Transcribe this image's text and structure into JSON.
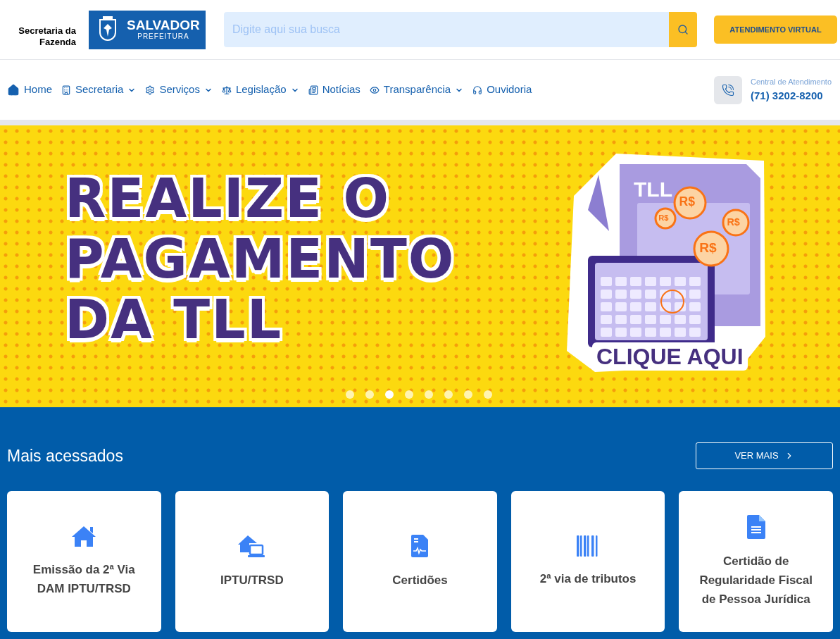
{
  "header": {
    "org_name": "Secretaria da Fazenda",
    "logo": {
      "title": "SALVADOR",
      "subtitle": "PREFEITURA"
    },
    "search": {
      "placeholder": "Digite aqui sua busca"
    },
    "cta": "ATENDIMENTO VIRTUAL"
  },
  "nav": {
    "items": [
      {
        "label": "Home",
        "kind": "home",
        "dropdown": false
      },
      {
        "label": "Secretaria",
        "kind": "building",
        "dropdown": true
      },
      {
        "label": "Serviços",
        "kind": "gear",
        "dropdown": true
      },
      {
        "label": "Legislação",
        "kind": "scale",
        "dropdown": true
      },
      {
        "label": "Notícias",
        "kind": "news",
        "dropdown": false
      },
      {
        "label": "Transparência",
        "kind": "eye",
        "dropdown": true
      },
      {
        "label": "Ouvidoria",
        "kind": "headphones",
        "dropdown": false
      }
    ],
    "contact": {
      "label": "Central de Atendimento",
      "phone": "(71) 3202-8200"
    }
  },
  "banner": {
    "headline": [
      "REALIZE O",
      "PAGAMENTO",
      "DA TLL"
    ],
    "document_label": "TLL",
    "coins": [
      "R$",
      "R$",
      "R$",
      "R$"
    ],
    "cta": "CLIQUE AQUI",
    "dots": [
      {
        "selected": false
      },
      {
        "selected": false
      },
      {
        "selected": true
      },
      {
        "selected": false
      },
      {
        "selected": false
      },
      {
        "selected": false
      },
      {
        "selected": false
      },
      {
        "selected": false
      }
    ]
  },
  "most_accessed": {
    "title": "Mais acessados",
    "more_button": "VER MAIS",
    "cards": [
      {
        "kind": "house",
        "lines": [
          "Emissão da 2ª Via",
          "DAM IPTU/TRSD"
        ]
      },
      {
        "kind": "laptop",
        "lines": [
          "IPTU/TRSD"
        ]
      },
      {
        "kind": "certificate",
        "lines": [
          "Certidões"
        ]
      },
      {
        "kind": "barcode",
        "lines": [
          "2ª via de tributos"
        ]
      },
      {
        "kind": "document",
        "lines": [
          "Certidão de",
          "Regularidade Fiscal",
          "de Pessoa Jurídica"
        ]
      }
    ]
  }
}
